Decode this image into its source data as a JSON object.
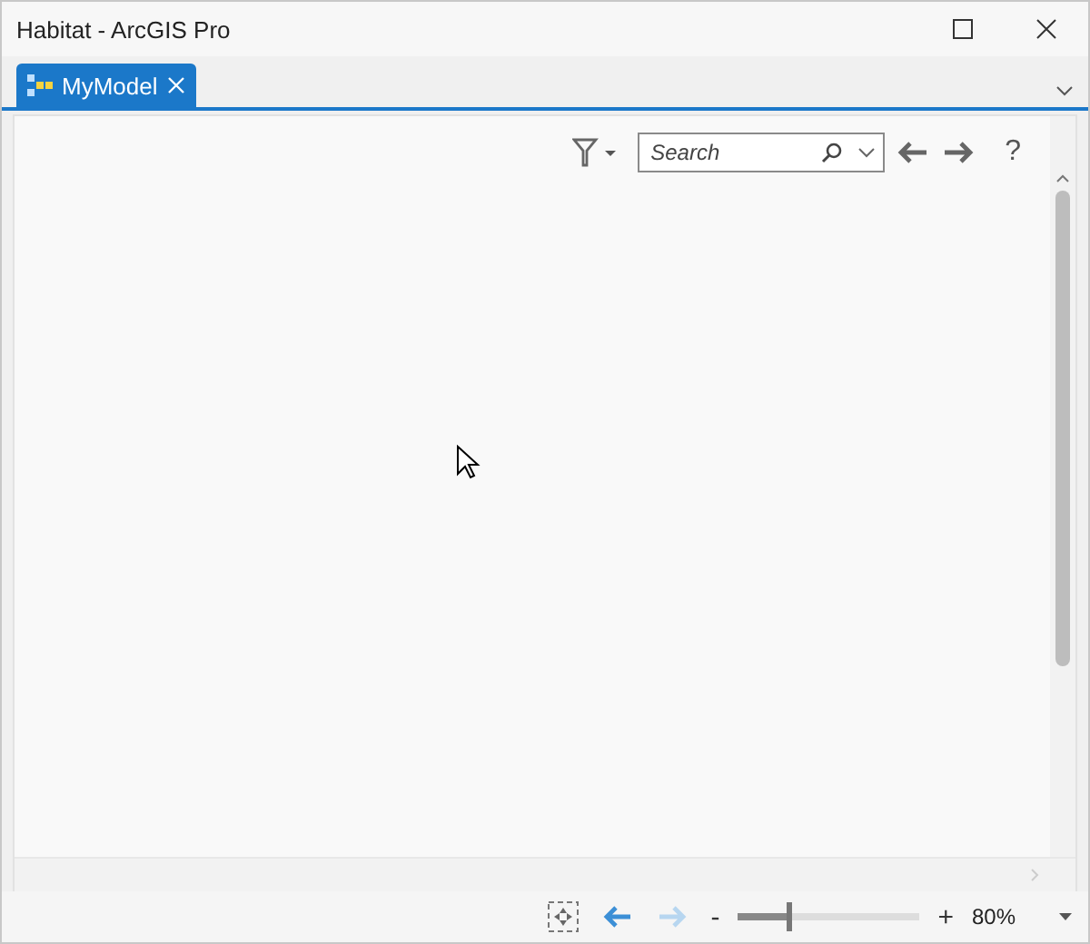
{
  "window": {
    "title": "Habitat - ArcGIS Pro"
  },
  "tabs": [
    {
      "label": "MyModel",
      "selected": true
    }
  ],
  "toolbar": {
    "search": {
      "placeholder": "Search"
    },
    "help": "?"
  },
  "footer": {
    "back": {
      "disabled": false
    },
    "forward": {
      "disabled": true
    },
    "zoom": {
      "minus": "-",
      "plus": "+",
      "level": 0.3,
      "value": "80%"
    }
  }
}
